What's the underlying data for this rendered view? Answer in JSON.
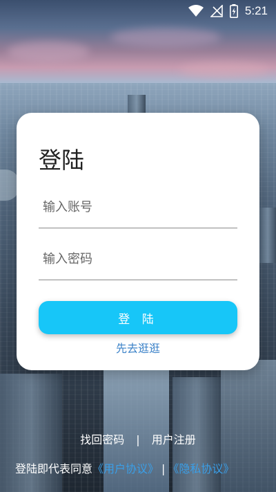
{
  "status_bar": {
    "time": "5:21",
    "icons": [
      "wifi-icon",
      "no-signal-icon",
      "battery-charging-icon"
    ]
  },
  "login_card": {
    "title": "登陆",
    "account_placeholder": "输入账号",
    "password_placeholder": "输入密码",
    "login_button": "登 陆",
    "browse_link": "先去逛逛"
  },
  "footer": {
    "find_password": "找回密码",
    "divider": "|",
    "register": "用户注册",
    "agreement_prefix": "登陆即代表同意",
    "user_agreement": "《用户协议》",
    "agreement_divider": "|",
    "privacy_agreement": "《隐私协议》"
  },
  "colors": {
    "accent": "#17c6f8",
    "link": "#3b82c8",
    "agreement_link": "#3a9fe8"
  }
}
